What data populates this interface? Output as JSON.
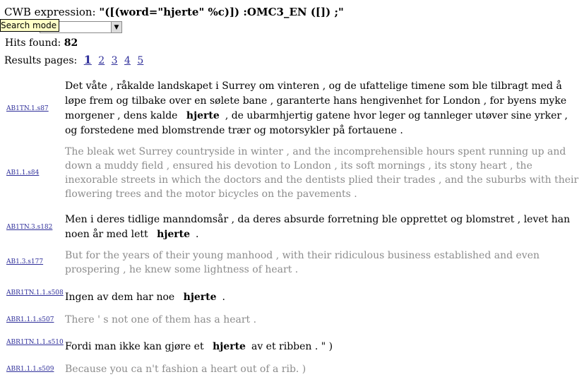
{
  "header": {
    "expression_label": "CWB expression:",
    "expression_value": "\"([(word=\"hjerte\" %c)]) :OMC3_EN ([]) ;\""
  },
  "search_mode": {
    "tooltip": "Search mode",
    "selected_value": ""
  },
  "hits": {
    "label": "Hits found:",
    "count": "82"
  },
  "results_pages": {
    "label": "Results pages:",
    "pages": [
      "1",
      "2",
      "3",
      "4",
      "5"
    ],
    "current": "1"
  },
  "results": [
    {
      "no_id": "AB1TN.1.s87",
      "no_before": "Det våte , råkalde landskapet i Surrey om vinteren , og de ufattelige timene som ble tilbragt med å løpe frem og tilbake over en sølete bane , garanterte hans hengivenhet for London , for byens myke morgener , dens kalde",
      "no_match": "hjerte",
      "no_after": ", de ubarmhjertig gatene hvor leger og tannleger utøver sine yrker , og forstedene med blomstrende trær og motorsykler på fortauene .",
      "en_id": "AB1.1.s84",
      "en_text": "The bleak wet Surrey countryside in winter , and the incomprehensible hours spent running up and down a muddy field , ensured his devotion to London , its soft mornings , its stony heart , the inexorable streets in which the doctors and the dentists plied their trades , and the suburbs with their flowering trees and the motor bicycles on the pavements ."
    },
    {
      "no_id": "AB1TN.3.s182",
      "no_before": "Men i deres tidlige manndomsår , da deres absurde forretning ble opprettet og blomstret , levet han noen år med lett",
      "no_match": "hjerte",
      "no_after": ".",
      "en_id": "AB1.3.s177",
      "en_text": "But for the years of their young manhood , with their ridiculous business established and even prospering , he knew some lightness of heart ."
    },
    {
      "no_id": "ABR1TN.1.1.s508",
      "no_before": "Ingen av dem har noe",
      "no_match": "hjerte",
      "no_after": ".",
      "en_id": "ABR1.1.1.s507",
      "en_text": "There ' s not one of them has a heart ."
    },
    {
      "no_id": "ABR1TN.1.1.s510",
      "no_before": "Fordi man ikke kan gjøre et",
      "no_match": "hjerte",
      "no_after": "av et ribben . \" )",
      "en_id": "ABR1.1.1.s509",
      "en_text": "Because you ca n't fashion a heart out of a rib. )"
    }
  ]
}
